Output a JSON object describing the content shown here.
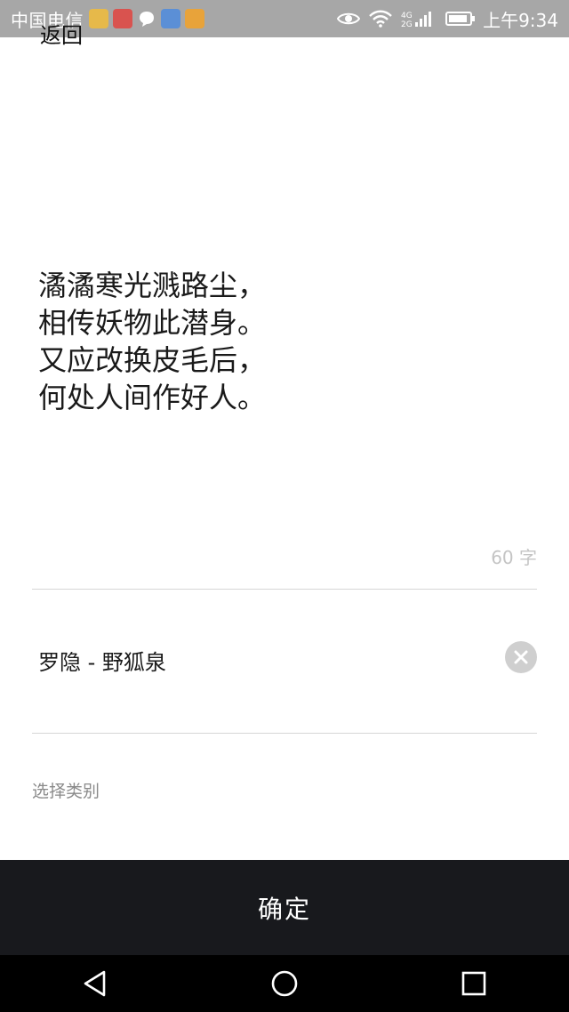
{
  "status_bar": {
    "carrier": "中国电信",
    "network_label": "4G 2G",
    "battery_level": 0.9,
    "time": "上午9:34"
  },
  "header": {
    "back_label": "返回"
  },
  "poem": {
    "lines": [
      "潏潏寒光溅路尘，",
      "相传妖物此潜身。",
      "又应改换皮毛后，",
      "何处人间作好人。"
    ],
    "char_count": "60 字"
  },
  "author": {
    "value": "罗隐  - 野狐泉"
  },
  "category": {
    "placeholder": "选择类别"
  },
  "confirm": {
    "label": "确定"
  },
  "colors": {
    "status_bar_bg": "#a7a7a7",
    "confirm_bar_bg": "#18191d",
    "nav_bar_bg": "#000000"
  },
  "icons": {
    "back_nav": "triangle-back-icon",
    "home_nav": "circle-home-icon",
    "recent_nav": "square-recent-icon",
    "clear": "close-circle-icon"
  }
}
